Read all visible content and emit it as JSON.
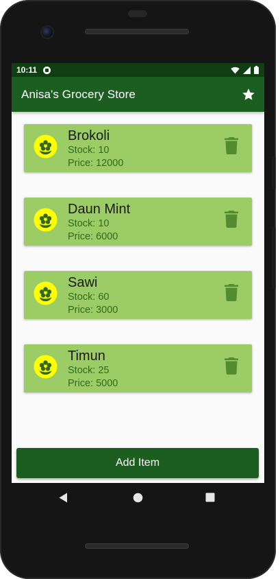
{
  "status_bar": {
    "time": "10:11",
    "icons": [
      "google-play-icon",
      "wifi-icon",
      "signal-icon",
      "battery-icon"
    ]
  },
  "app_bar": {
    "title": "Anisa's Grocery Store",
    "action_icon": "star-icon"
  },
  "items": [
    {
      "name": "Brokoli",
      "stock": "Stock: 10",
      "price": "Price: 12000"
    },
    {
      "name": "Daun Mint",
      "stock": "Stock: 10",
      "price": "Price: 6000"
    },
    {
      "name": "Sawi",
      "stock": "Stock: 60",
      "price": "Price: 3000"
    },
    {
      "name": "Timun",
      "stock": "Stock: 25",
      "price": "Price: 5000"
    }
  ],
  "item_icon": "flower-icon",
  "delete_icon": "trash-icon",
  "add_button": {
    "label": "Add Item"
  },
  "nav": [
    "back-icon",
    "home-icon",
    "recents-icon"
  ],
  "colors": {
    "primary": "#1b5e20",
    "status_bar": "#103f14",
    "card": "#9ccc65",
    "icon_fill": "#ffff00",
    "icon_glyph": "#33691e"
  }
}
